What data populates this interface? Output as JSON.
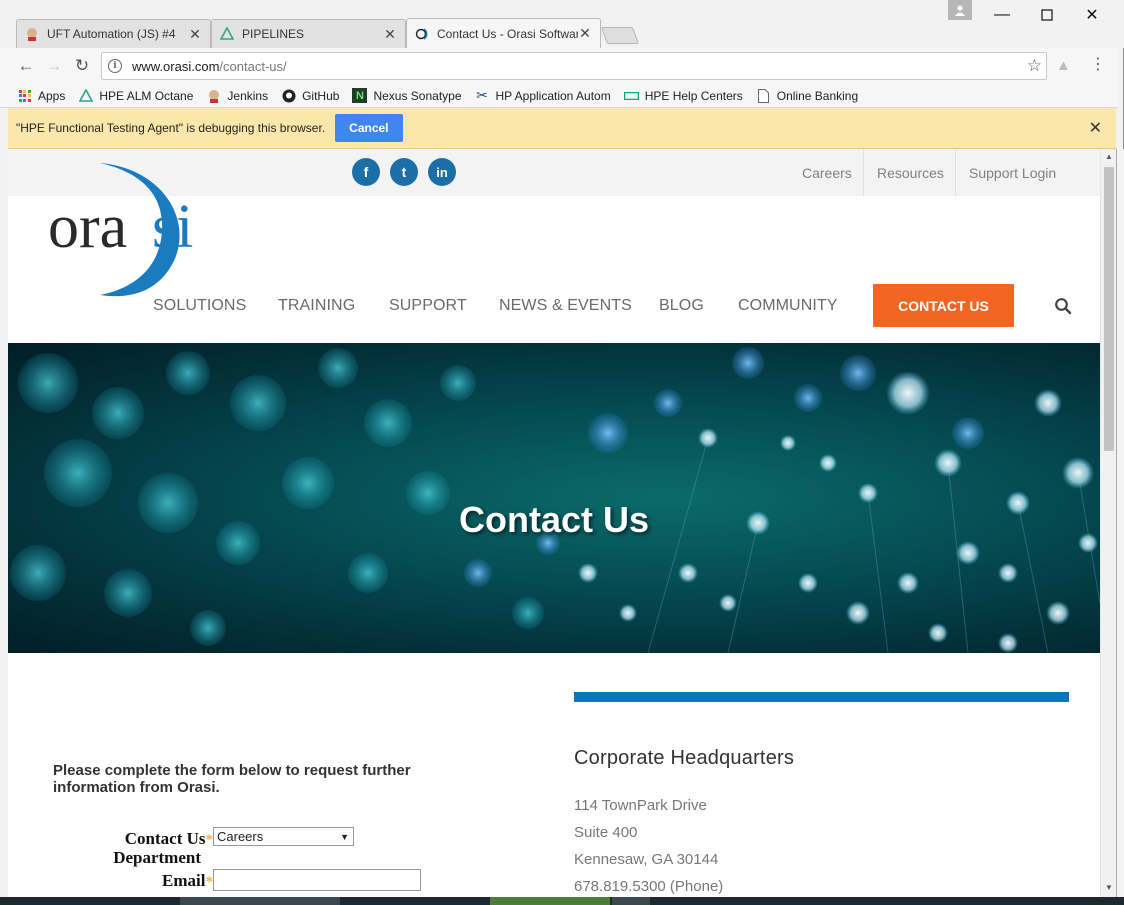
{
  "browser": {
    "tabs": [
      {
        "title": "UFT Automation (JS) #4"
      },
      {
        "title": "PIPELINES"
      },
      {
        "title": "Contact Us - Orasi Software"
      }
    ],
    "url_host": "www.orasi.com",
    "url_path": "/contact-us/",
    "bookmarks": [
      {
        "label": "Apps",
        "icon": "apps-grid-icon"
      },
      {
        "label": "HPE ALM Octane",
        "icon": "octane-icon"
      },
      {
        "label": "Jenkins",
        "icon": "jenkins-icon"
      },
      {
        "label": "GitHub",
        "icon": "github-icon"
      },
      {
        "label": "Nexus Sonatype",
        "icon": "nexus-icon"
      },
      {
        "label": "HP Application Autom",
        "icon": "hp-icon"
      },
      {
        "label": "HPE Help Centers",
        "icon": "hpe-icon"
      },
      {
        "label": "Online Banking",
        "icon": "page-icon"
      }
    ],
    "infobar": {
      "message": "\"HPE Functional Testing Agent\" is debugging this browser.",
      "cancel_label": "Cancel"
    }
  },
  "site": {
    "top_links": [
      "Careers",
      "Resources",
      "Support Login"
    ],
    "social": [
      {
        "label": "f",
        "icon": "facebook-icon"
      },
      {
        "label": "t",
        "icon": "twitter-icon"
      },
      {
        "label": "in",
        "icon": "linkedin-icon"
      }
    ],
    "logo_text": "orasi",
    "nav": [
      "SOLUTIONS",
      "TRAINING",
      "SUPPORT",
      "NEWS & EVENTS",
      "BLOG",
      "COMMUNITY"
    ],
    "cta_label": "CONTACT US",
    "hero_title": "Contact Us",
    "form": {
      "intro": "Please complete the form below to request further information from Orasi.",
      "dept_label_line1": "Contact Us",
      "dept_label_line2": "Department",
      "dept_value": "Careers",
      "email_label": "Email",
      "required_mark": "*"
    },
    "hq": {
      "title": "Corporate Headquarters",
      "address": [
        "114 TownPark Drive",
        "Suite 400",
        "Kennesaw, GA 30144",
        "678.819.5300 (Phone)"
      ]
    },
    "colors": {
      "brand_blue": "#0d75b8",
      "cta_orange": "#f26522",
      "social_blue": "#1b6fa6",
      "infobar_yellow": "#fbe7a9"
    }
  }
}
